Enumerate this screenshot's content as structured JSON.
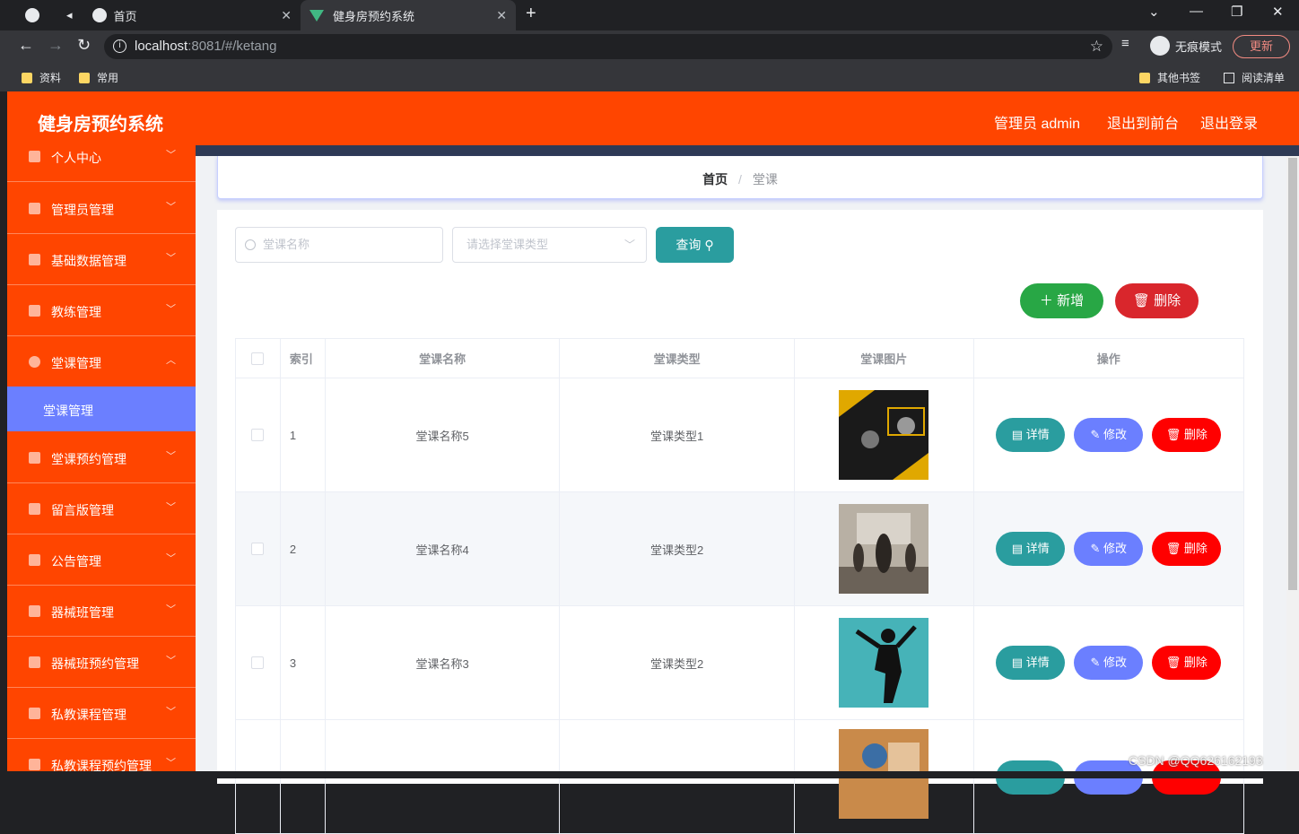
{
  "browser": {
    "tabs": [
      {
        "label": "首页"
      },
      {
        "label": "健身房预约系统"
      }
    ],
    "url_host": "localhost",
    "url_path": ":8081/#/ketang",
    "incognito_label": "无痕模式",
    "update_label": "更新",
    "bookmarks": [
      "资料",
      "常用"
    ],
    "other_bookmarks": "其他书签",
    "reading_list": "阅读清单"
  },
  "header": {
    "title": "健身房预约系统",
    "admin_label": "管理员 admin",
    "frontend_link": "退出到前台",
    "logout_link": "退出登录",
    "color": "#ff4500"
  },
  "sidebar": {
    "items": [
      {
        "label": "个人中心",
        "icon": "user-icon"
      },
      {
        "label": "管理员管理",
        "icon": "admin-icon"
      },
      {
        "label": "基础数据管理",
        "icon": "data-icon"
      },
      {
        "label": "教练管理",
        "icon": "coach-icon"
      },
      {
        "label": "堂课管理",
        "icon": "compass-icon",
        "expanded": true
      },
      {
        "label": "堂课预约管理",
        "icon": "mic-icon"
      },
      {
        "label": "留言版管理",
        "icon": "message-icon"
      },
      {
        "label": "公告管理",
        "icon": "chart-icon"
      },
      {
        "label": "器械班管理",
        "icon": "equipment-icon"
      },
      {
        "label": "器械班预约管理",
        "icon": "clipboard-icon"
      },
      {
        "label": "私教课程管理",
        "icon": "monitor-icon"
      },
      {
        "label": "私教课程预约管理",
        "icon": "crop-icon"
      }
    ],
    "active_sub": "堂课管理",
    "active_color": "#6b7fff"
  },
  "breadcrumb": {
    "home": "首页",
    "current": "堂课"
  },
  "search": {
    "name_placeholder": "堂课名称",
    "type_placeholder": "请选择堂课类型",
    "query_label": "查询"
  },
  "actions": {
    "add_label": "新增",
    "delete_label": "删除"
  },
  "table": {
    "headers": [
      "索引",
      "堂课名称",
      "堂课类型",
      "堂课图片",
      "操作"
    ],
    "rows": [
      {
        "index": "1",
        "name": "堂课名称5",
        "type": "堂课类型1"
      },
      {
        "index": "2",
        "name": "堂课名称4",
        "type": "堂课类型2"
      },
      {
        "index": "3",
        "name": "堂课名称3",
        "type": "堂课类型2"
      },
      {
        "index": "",
        "name": "",
        "type": ""
      }
    ],
    "op_labels": {
      "detail": "详情",
      "edit": "修改",
      "delete": "删除"
    }
  },
  "watermark": "CSDN @QQ626162193"
}
